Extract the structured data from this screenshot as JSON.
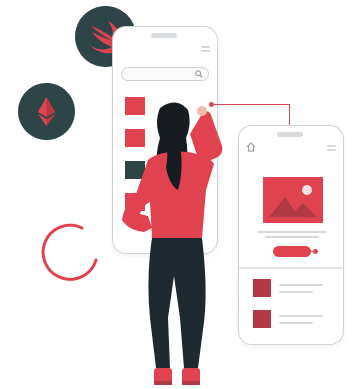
{
  "illustration": {
    "badges": [
      {
        "name": "swift-badge",
        "icon": "swift-icon"
      },
      {
        "name": "ethereum-badge",
        "icon": "ethereum-icon"
      }
    ],
    "decorations": [
      "loading-arc-icon"
    ],
    "phones": [
      {
        "name": "back-phone",
        "content": [
          "search-bar",
          "image-placeholders",
          "text-lines"
        ]
      },
      {
        "name": "front-phone",
        "content": [
          "home-icon",
          "menu-icon",
          "image-card",
          "action-pill",
          "list-items"
        ]
      }
    ],
    "figure": "woman-pointing-at-screen"
  },
  "colors": {
    "accent_red": "#e0434f",
    "dark_red": "#b23a44",
    "badge_dark": "#2e4547",
    "outline_gray": "#cfd3d6",
    "pants": "#1e2a2f",
    "hair": "#161c1f",
    "skin": "#f1b9a7"
  }
}
